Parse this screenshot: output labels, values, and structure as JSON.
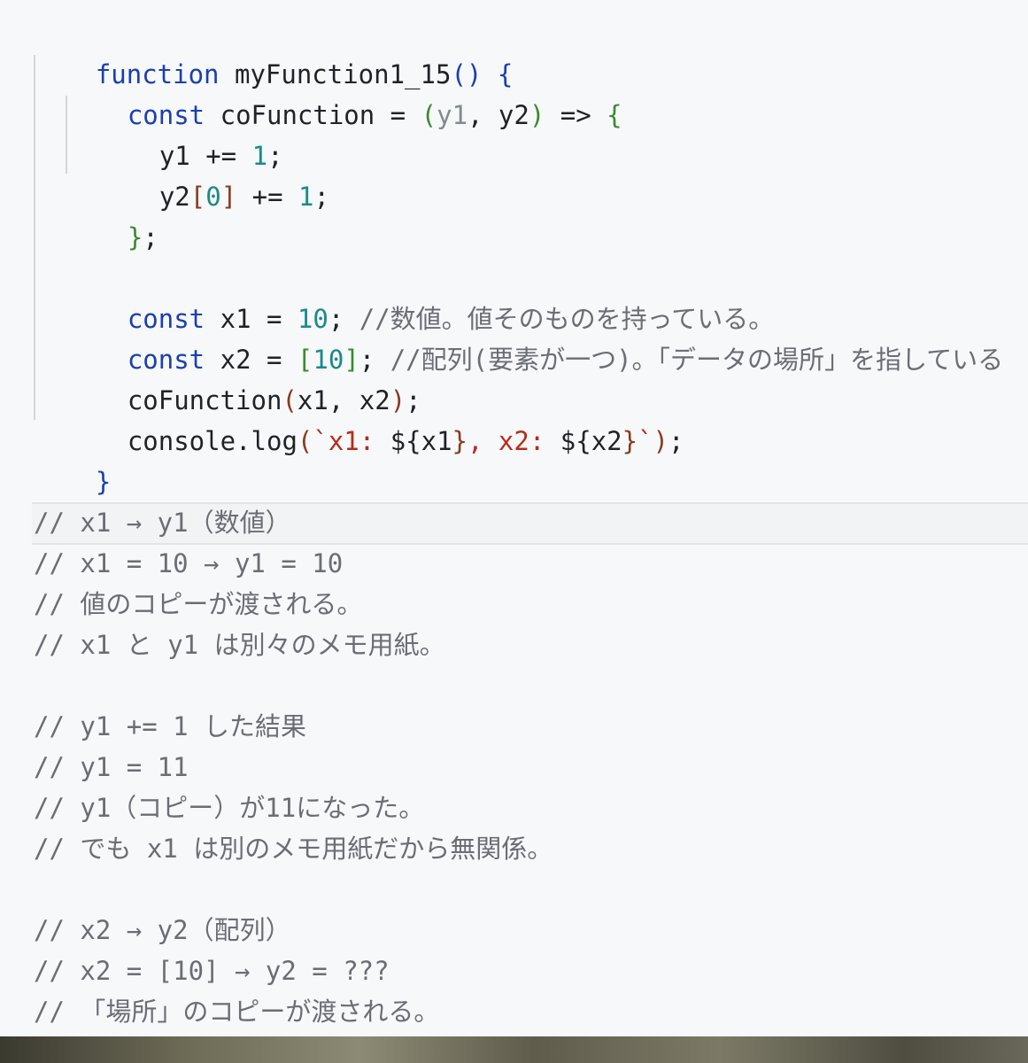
{
  "code": {
    "l1": {
      "kw": "function",
      "name": " myFunction1_15",
      "open": "()",
      "sp": " ",
      "brace": "{"
    },
    "l2": {
      "kw": "const",
      "mid": " coFunction = ",
      "po": "(",
      "a1": "y1",
      "comma": ", ",
      "a2": "y2",
      "pc": ")",
      "arrow": " => ",
      "brace": "{"
    },
    "l3": {
      "t1": "y1 += ",
      "n": "1",
      "t2": ";"
    },
    "l4": {
      "t1": "y2",
      "bo": "[",
      "n": "0",
      "bc": "]",
      "t2": " += ",
      "n2": "1",
      "t3": ";"
    },
    "l5": {
      "brace": "}",
      "t": ";"
    },
    "l7": {
      "kw": "const",
      "t1": " x1 = ",
      "n": "10",
      "t2": "; ",
      "cm": "//数値。値そのものを持っている。"
    },
    "l8": {
      "kw": "const",
      "t1": " x2 = ",
      "bo": "[",
      "n": "10",
      "bc": "]",
      "t2": "; ",
      "cm": "//配列(要素が一つ)。「データの場所」を指している"
    },
    "l9": {
      "t1": "coFunction",
      "po": "(",
      "t2": "x1, x2",
      "pc": ")",
      "t3": ";"
    },
    "l10": {
      "t1": "console.log",
      "po": "(",
      "s1": "`x1: ",
      "v1o": "${",
      "v1": "x1",
      "v1c": "}",
      "s2": ", x2: ",
      "v2o": "${",
      "v2": "x2",
      "v2c": "}",
      "s3": "`",
      "pc": ")",
      "t2": ";"
    },
    "l11": {
      "brace": "}"
    }
  },
  "comments": [
    "// x1 → y1（数値）",
    "// x1 = 10 → y1 = 10",
    "// 値のコピーが渡される。",
    "// x1 と y1 は別々のメモ用紙。",
    "",
    "// y1 += 1 した結果",
    "// y1 = 11",
    "// y1（コピー）が11になった。",
    "// でも x1 は別のメモ用紙だから無関係。",
    "",
    "// x2 → y2（配列）",
    "// x2 = [10] → y2 = ???",
    "// 「場所」のコピーが渡される。"
  ]
}
